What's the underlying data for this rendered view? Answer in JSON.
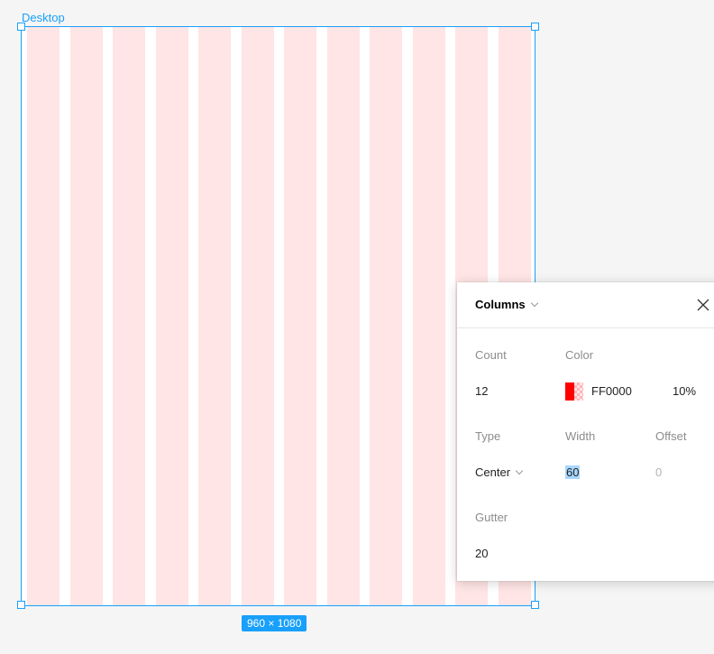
{
  "frame": {
    "label": "Desktop",
    "size_badge": "960 × 1080",
    "column_color": "#ffe5e5",
    "selection_color": "#18a0fb",
    "column_count": 12
  },
  "panel": {
    "title": "Columns",
    "close_icon": "close-icon",
    "count": {
      "label": "Count",
      "value": "12"
    },
    "color": {
      "label": "Color",
      "hex": "FF0000",
      "opacity": "10%",
      "swatch": "#ff0000"
    },
    "type": {
      "label": "Type",
      "value": "Center"
    },
    "width": {
      "label": "Width",
      "value": "60"
    },
    "offset": {
      "label": "Offset",
      "value": "0"
    },
    "gutter": {
      "label": "Gutter",
      "value": "20"
    }
  }
}
